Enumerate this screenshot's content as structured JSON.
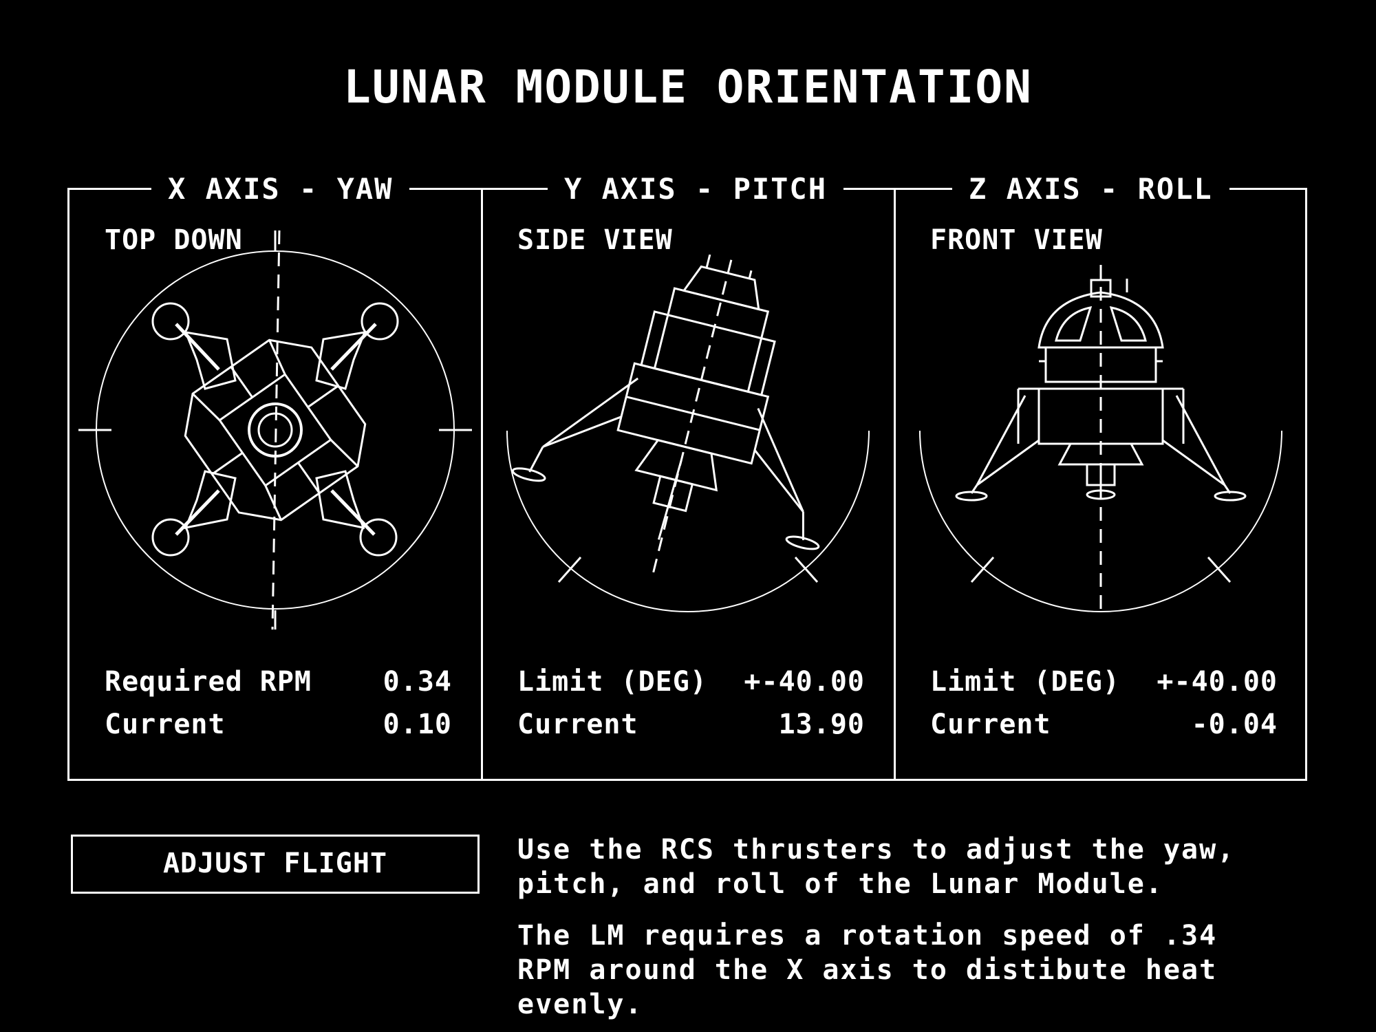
{
  "title": "LUNAR MODULE ORIENTATION",
  "panels": [
    {
      "heading": "X AXIS - YAW",
      "view": "TOP DOWN",
      "row1_label": "Required RPM",
      "row1_value": "0.34",
      "row2_label": "Current",
      "row2_value": "0.10",
      "icon": "lunar-module-top-view"
    },
    {
      "heading": "Y AXIS - PITCH",
      "view": "SIDE VIEW",
      "row1_label": "Limit (DEG)",
      "row1_value": "+-40.00",
      "row2_label": "Current",
      "row2_value": "13.90",
      "icon": "lunar-module-side-view"
    },
    {
      "heading": "Z AXIS - ROLL",
      "view": "FRONT VIEW",
      "row1_label": "Limit (DEG)",
      "row1_value": "+-40.00",
      "row2_label": "Current",
      "row2_value": "-0.04",
      "icon": "lunar-module-front-view"
    }
  ],
  "button_label": "ADJUST FLIGHT",
  "info": [
    "Use the RCS thrusters to adjust the yaw, pitch, and roll of the Lunar Module.",
    "The LM requires a rotation speed of .34 RPM around the X axis to distibute heat evenly."
  ]
}
